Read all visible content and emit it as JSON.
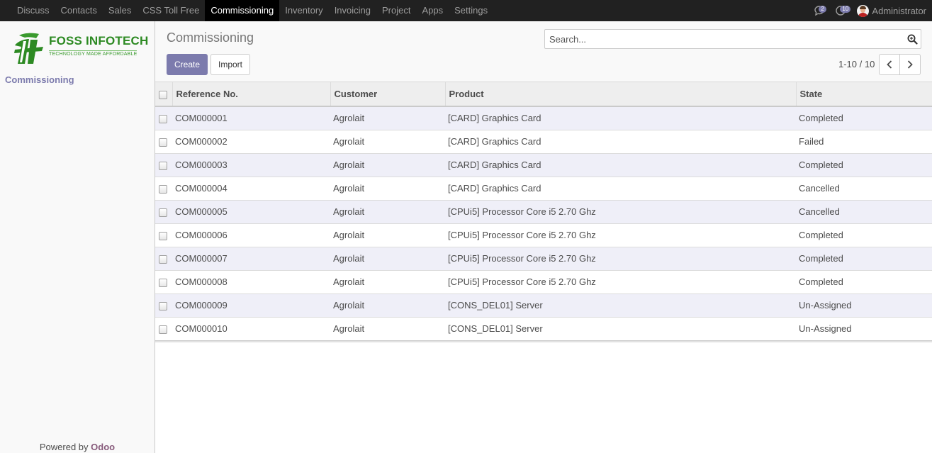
{
  "topnav": {
    "items": [
      {
        "label": "Discuss",
        "active": false
      },
      {
        "label": "Contacts",
        "active": false
      },
      {
        "label": "Sales",
        "active": false
      },
      {
        "label": "CSS Toll Free",
        "active": false
      },
      {
        "label": "Commissioning",
        "active": true
      },
      {
        "label": "Inventory",
        "active": false
      },
      {
        "label": "Invoicing",
        "active": false
      },
      {
        "label": "Project",
        "active": false
      },
      {
        "label": "Apps",
        "active": false
      },
      {
        "label": "Settings",
        "active": false
      }
    ],
    "chat_badge": "2",
    "activity_badge": "10",
    "user_name": "Administrator"
  },
  "sidebar": {
    "logo_text": "FOSS INFOTECH",
    "logo_tagline": "TECHNOLOGY MADE AFFORDABLE",
    "menu_item": "Commissioning",
    "powered_prefix": "Powered by ",
    "powered_brand": "Odoo"
  },
  "control_panel": {
    "title": "Commissioning",
    "search_placeholder": "Search...",
    "create_label": "Create",
    "import_label": "Import",
    "pager_text": "1-10 / 10"
  },
  "table": {
    "columns": [
      "Reference No.",
      "Customer",
      "Product",
      "State"
    ],
    "rows": [
      [
        "COM000001",
        "Agrolait",
        "[CARD] Graphics Card",
        "Completed"
      ],
      [
        "COM000002",
        "Agrolait",
        "[CARD] Graphics Card",
        "Failed"
      ],
      [
        "COM000003",
        "Agrolait",
        "[CARD] Graphics Card",
        "Completed"
      ],
      [
        "COM000004",
        "Agrolait",
        "[CARD] Graphics Card",
        "Cancelled"
      ],
      [
        "COM000005",
        "Agrolait",
        "[CPUi5] Processor Core i5 2.70 Ghz",
        "Cancelled"
      ],
      [
        "COM000006",
        "Agrolait",
        "[CPUi5] Processor Core i5 2.70 Ghz",
        "Completed"
      ],
      [
        "COM000007",
        "Agrolait",
        "[CPUi5] Processor Core i5 2.70 Ghz",
        "Completed"
      ],
      [
        "COM000008",
        "Agrolait",
        "[CPUi5] Processor Core i5 2.70 Ghz",
        "Completed"
      ],
      [
        "COM000009",
        "Agrolait",
        "[CONS_DEL01] Server",
        "Un-Assigned"
      ],
      [
        "COM000010",
        "Agrolait",
        "[CONS_DEL01] Server",
        "Un-Assigned"
      ]
    ]
  },
  "colors": {
    "primary": "#7c7bad",
    "navbar": "#212121",
    "brand_green": "#2d8a23",
    "odoo": "#875a7b"
  }
}
